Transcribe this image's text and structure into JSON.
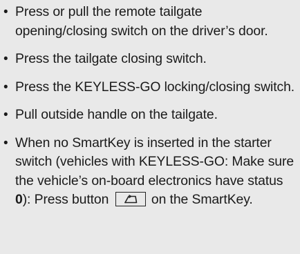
{
  "bullet_char": "•",
  "items": [
    {
      "text": "Press or pull the remote tailgate opening/closing switch on the driver’s door."
    },
    {
      "text": "Press the tailgate closing switch."
    },
    {
      "text": "Press the KEYLESS-GO locking/closing switch."
    },
    {
      "text": "Pull outside handle on the tailgate."
    },
    {
      "text_before": "When no SmartKey is inserted in the starter switch (vehicles with KEYLESS-GO: Make sure the vehicle’s on-board electronics have status ",
      "status_value": "0",
      "text_middle": "): Press button",
      "button_icon": "tailgate-button-icon",
      "text_after": "on the SmartKey."
    }
  ]
}
